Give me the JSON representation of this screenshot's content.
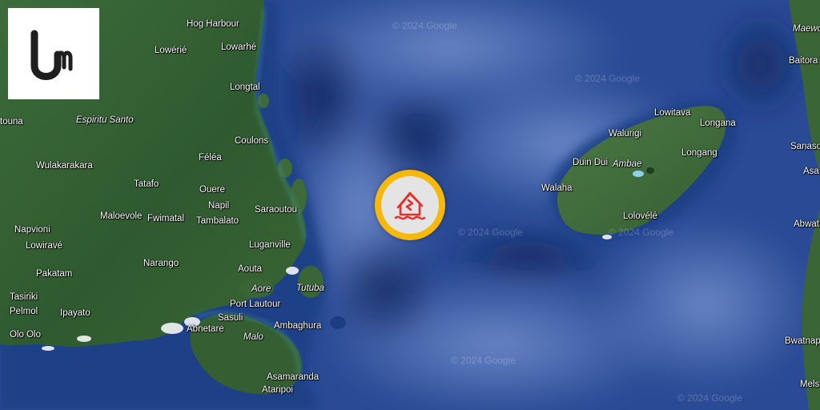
{
  "brand": {
    "logo_icon": "um-monogram-logo"
  },
  "marker": {
    "icon": "earthquake-damaged-house-icon",
    "ring_color": "#f6b80c",
    "icon_color": "#e8302c"
  },
  "places": {
    "hog_harbour": "Hog Harbour",
    "lowerie": "Lowérié",
    "lowarhe": "Lowarhé",
    "longtal": "Longtal",
    "tuna": "touna",
    "espiritu_santo": "Espiritu Santo",
    "coulons": "Coulons",
    "felea": "Féléa",
    "wulakarakara": "Wulakarakara",
    "tatafo": "Tatafo",
    "ouere": "Ouere",
    "napil": "Napil",
    "saraoutou": "Saraoutou",
    "maloevole": "Maloevole",
    "fwimatal": "Fwimatal",
    "tambalato": "Tambalato",
    "napvioni": "Napvioni",
    "luganville": "Luganville",
    "lowirave": "Lowiravé",
    "narango": "Narango",
    "aouta": "Aouta",
    "pakatam": "Pakatam",
    "aore": "Aore",
    "tutuba": "Tutuba",
    "tasiriki": "Tasiriki",
    "port_lautour": "Port Lautour",
    "pelmol": "Pelmol",
    "ipayato": "Ipayato",
    "sasuli": "Sasuli",
    "abnetare": "Abnetare",
    "ambaghura": "Ambaghura",
    "olo_olo": "Olo Olo",
    "malo": "Malo",
    "asamaranda": "Asamaranda",
    "ataripoi": "Ataripoi",
    "lowitava": "Lowitava",
    "walurigi": "Walurigi",
    "longana": "Longana",
    "longang": "Longang",
    "duin_dui": "Duin Dui",
    "ambae": "Ambae",
    "walaha": "Walaha",
    "lolovele": "Lolovélé",
    "maewo": "Maewo",
    "baitora": "Baitora",
    "sanaso": "Sanaso",
    "asa": "Asa",
    "abwat": "Abwat",
    "bwatnap": "Bwatnap",
    "mels": "Mels"
  },
  "watermarks": {
    "w1": "© 2024 Google",
    "w2": "© 2024 Google",
    "w3": "© 2024 Google",
    "w4": "© 2024 Google",
    "w5": "© 2024 Google",
    "w6": "© 2024 Google"
  }
}
